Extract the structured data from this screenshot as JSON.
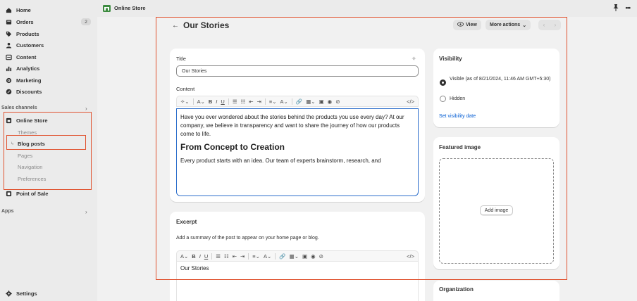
{
  "sidebar": {
    "nav": [
      {
        "label": "Home",
        "icon": "home-icon"
      },
      {
        "label": "Orders",
        "icon": "orders-icon",
        "badge": "2"
      },
      {
        "label": "Products",
        "icon": "tag-icon"
      },
      {
        "label": "Customers",
        "icon": "person-icon"
      },
      {
        "label": "Content",
        "icon": "content-icon"
      },
      {
        "label": "Analytics",
        "icon": "analytics-icon"
      },
      {
        "label": "Marketing",
        "icon": "target-icon"
      },
      {
        "label": "Discounts",
        "icon": "discount-icon"
      }
    ],
    "sales_channels_label": "Sales channels",
    "online_store_label": "Online Store",
    "sub_items": [
      "Themes",
      "Blog posts",
      "Pages",
      "Navigation",
      "Preferences"
    ],
    "pos_label": "Point of Sale",
    "apps_label": "Apps",
    "settings_label": "Settings"
  },
  "topbar": {
    "store_name": "Online Store",
    "pin_icon": "pin-icon",
    "more_icon": "more-horizontal-icon"
  },
  "header": {
    "title": "Our Stories",
    "view_label": "View",
    "more_actions_label": "More actions"
  },
  "title_card": {
    "title_label": "Title",
    "title_value": "Our Stories",
    "content_label": "Content",
    "content_paragraph": "Have you ever wondered about the stories behind the products you use every day? At our company, we believe in transparency and want to share the journey of how our products come to life.",
    "content_heading": "From Concept to Creation",
    "content_paragraph2": "Every product starts with an idea. Our team of experts brainstorm, research, and"
  },
  "excerpt_card": {
    "title": "Excerpt",
    "hint": "Add a summary of the post to appear on your home page or blog.",
    "value": "Our Stories"
  },
  "visibility_card": {
    "title": "Visibility",
    "visible_label": "Visible (as of 8/21/2024, 11:46 AM GMT+5:30)",
    "hidden_label": "Hidden",
    "set_date_link": "Set visibility date"
  },
  "featured_card": {
    "title": "Featured image",
    "add_image_label": "Add image"
  },
  "organization_card": {
    "title": "Organization"
  },
  "colors": {
    "highlight": "#e0522f",
    "focus": "#2c6ecb",
    "link": "#005bd3"
  }
}
